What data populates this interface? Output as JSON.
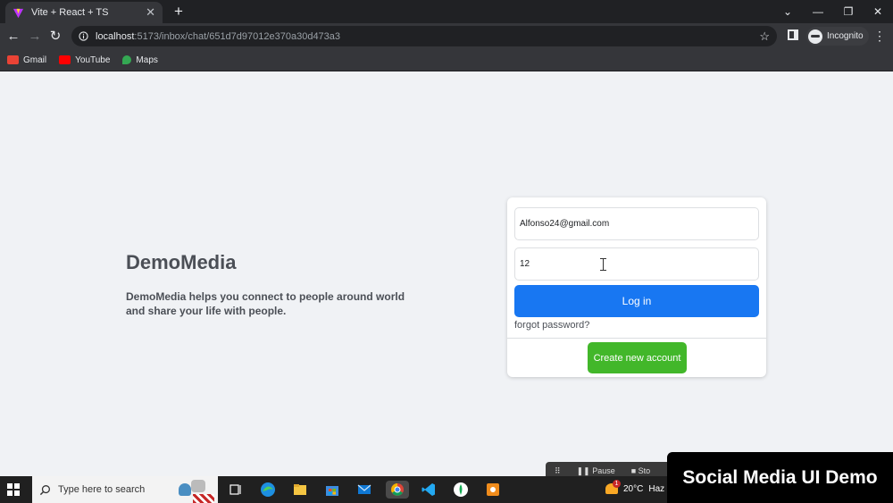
{
  "browser": {
    "tab_title": "Vite + React + TS",
    "address_host": "localhost",
    "address_path": ":5173/inbox/chat/651d7d97012e370a30d473a3",
    "profile_label": "Incognito",
    "bookmarks": [
      {
        "label": "Gmail",
        "icon": "gmail-icon",
        "color": "#ea4335"
      },
      {
        "label": "YouTube",
        "icon": "youtube-icon",
        "color": "#ff0000"
      },
      {
        "label": "Maps",
        "icon": "maps-icon",
        "color": "#34a853"
      }
    ]
  },
  "brand": {
    "name": "DemoMedia",
    "tagline": "DemoMedia helps you connect to people around world and share your life with people."
  },
  "login": {
    "email_value": "Alfonso24@gmail.com",
    "password_value": "12",
    "login_label": "Log in",
    "forgot_label": "forgot password?",
    "create_label": "Create new account"
  },
  "recorder": {
    "pause_label": "Pause",
    "stop_label": "Sto"
  },
  "taskbar": {
    "search_placeholder": "Type here to search",
    "weather_temp": "20°C",
    "weather_text": "Haz"
  },
  "overlay": {
    "caption": "Social Media UI Demo"
  },
  "colors": {
    "primary": "#1877f2",
    "success": "#42b72a",
    "page_bg": "#f0f2f5"
  }
}
